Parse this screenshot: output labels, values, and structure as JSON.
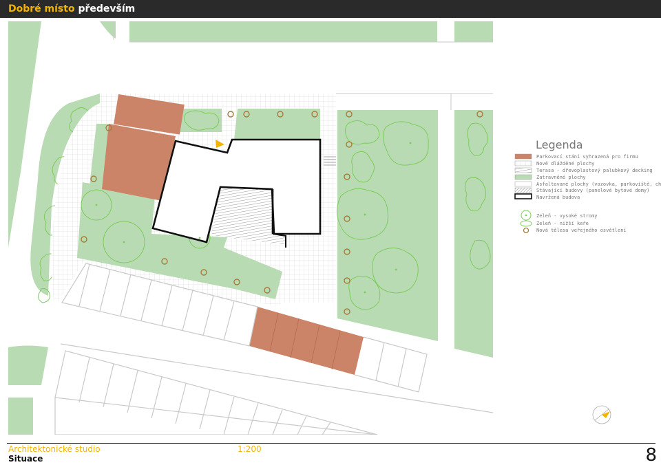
{
  "header": {
    "brand_part1": "Dobré místo",
    "brand_part2": "především"
  },
  "legend": {
    "title": "Legenda",
    "items": [
      {
        "label": "Parkovací stání vyhrazená pro firmu",
        "symbol": "parking-reserved"
      },
      {
        "label": "Nově dlážděné plochy",
        "symbol": "new-paving"
      },
      {
        "label": "Terasa - dřevoplastový palubkový decking",
        "symbol": "terrace-decking"
      },
      {
        "label": "Zatravněné plochy",
        "symbol": "grass"
      },
      {
        "label": "Asfaltované plochy (vozovka, parkoviště, chodníky)",
        "symbol": "asphalt"
      },
      {
        "label": "Stávající budovy (panelové bytové domy)",
        "symbol": "existing-buildings"
      },
      {
        "label": "Navržená budova",
        "symbol": "proposed-building"
      }
    ],
    "vegetation": [
      {
        "label": "Zeleň - vysoké stromy",
        "symbol": "tree-icon"
      },
      {
        "label": "Zeleň - nižší keře",
        "symbol": "shrub-icon"
      },
      {
        "label": "Nová tělesa veřejného osvětlení",
        "symbol": "lamp-icon"
      }
    ]
  },
  "colors": {
    "grass": "#b9dbb4",
    "parking": "#cc8468",
    "paving_line": "#cfcfcf",
    "tree": "#7ccc5a",
    "lamp": "#a67c3a",
    "building_stroke": "#111111",
    "accent": "#f2b400",
    "road_line": "#c9c9c9"
  },
  "footer": {
    "studio": "Architektonické studio",
    "sheet": "Situace",
    "scale": "1:200",
    "page": "8"
  }
}
